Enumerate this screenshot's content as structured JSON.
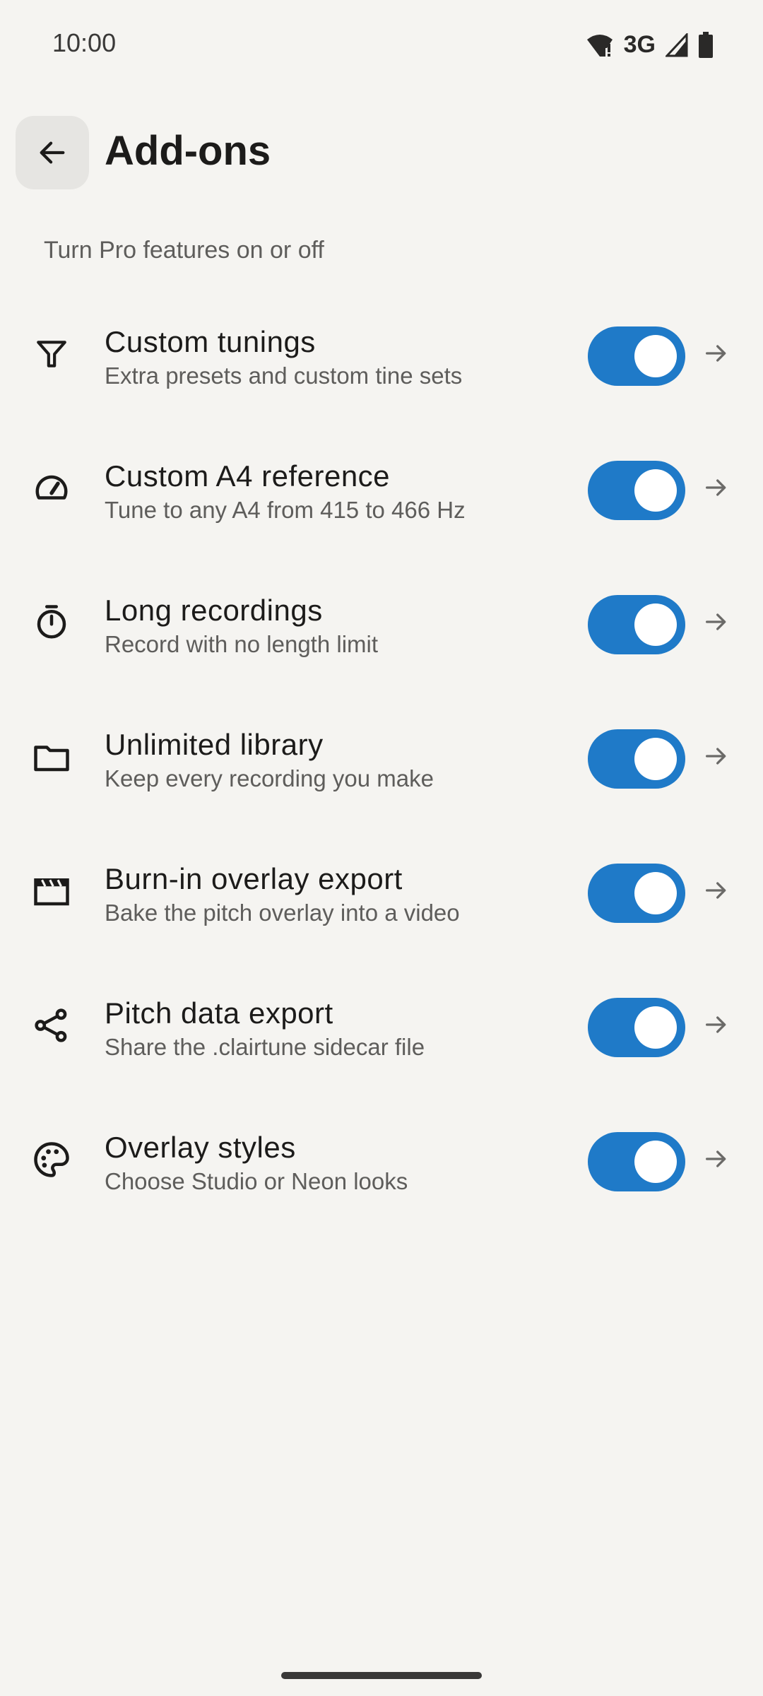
{
  "status_bar": {
    "time": "10:00",
    "network": "3G",
    "icons": [
      "wifi-alert-icon",
      "signal-icon",
      "battery-icon"
    ]
  },
  "header": {
    "back_icon": "arrow-left-icon",
    "title": "Add-ons"
  },
  "subtitle": "Turn Pro features on or off",
  "accent_color": "#1f7ac8",
  "items": [
    {
      "icon": "filter-icon",
      "title": "Custom tunings",
      "description": "Extra presets and custom tine sets",
      "enabled": true
    },
    {
      "icon": "gauge-icon",
      "title": "Custom A4 reference",
      "description": "Tune to any A4 from 415 to 466 Hz",
      "enabled": true
    },
    {
      "icon": "timer-icon",
      "title": "Long recordings",
      "description": "Record with no length limit",
      "enabled": true
    },
    {
      "icon": "folder-icon",
      "title": "Unlimited library",
      "description": "Keep every recording you make",
      "enabled": true
    },
    {
      "icon": "clapperboard-icon",
      "title": "Burn-in overlay export",
      "description": "Bake the pitch overlay into a video",
      "enabled": true
    },
    {
      "icon": "share-icon",
      "title": "Pitch data export",
      "description": "Share the .clairtune sidecar file",
      "enabled": true
    },
    {
      "icon": "palette-icon",
      "title": "Overlay styles",
      "description": "Choose Studio or Neon looks",
      "enabled": true
    }
  ]
}
